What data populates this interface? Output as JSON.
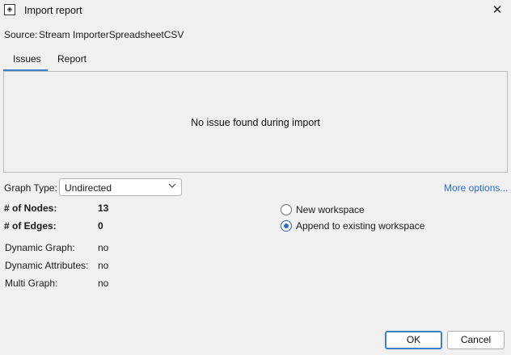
{
  "window": {
    "title": "Import report",
    "close_symbol": "✕"
  },
  "source": {
    "label": "Source:",
    "value": "Stream ImporterSpreadsheetCSV"
  },
  "tabs": [
    {
      "label": "Issues",
      "selected": true
    },
    {
      "label": "Report",
      "selected": false
    }
  ],
  "issues_panel": {
    "message": "No issue found during import"
  },
  "graph_type": {
    "label": "Graph Type:",
    "value": "Undirected"
  },
  "more_options": "More options...",
  "stats": {
    "nodes_label": "# of Nodes:",
    "nodes_value": "13",
    "edges_label": "# of Edges:",
    "edges_value": "0"
  },
  "info": {
    "dynamic_graph_label": "Dynamic Graph:",
    "dynamic_graph_value": "no",
    "dynamic_attributes_label": "Dynamic Attributes:",
    "dynamic_attributes_value": "no",
    "multi_graph_label": "Multi Graph:",
    "multi_graph_value": "no"
  },
  "workspace_options": [
    {
      "label": "New workspace",
      "checked": false
    },
    {
      "label": "Append to existing workspace",
      "checked": true
    }
  ],
  "buttons": {
    "ok": "OK",
    "cancel": "Cancel"
  },
  "colors": {
    "accent": "#3c7fc5",
    "link": "#2a6dc7",
    "background": "#f0f0f0"
  }
}
